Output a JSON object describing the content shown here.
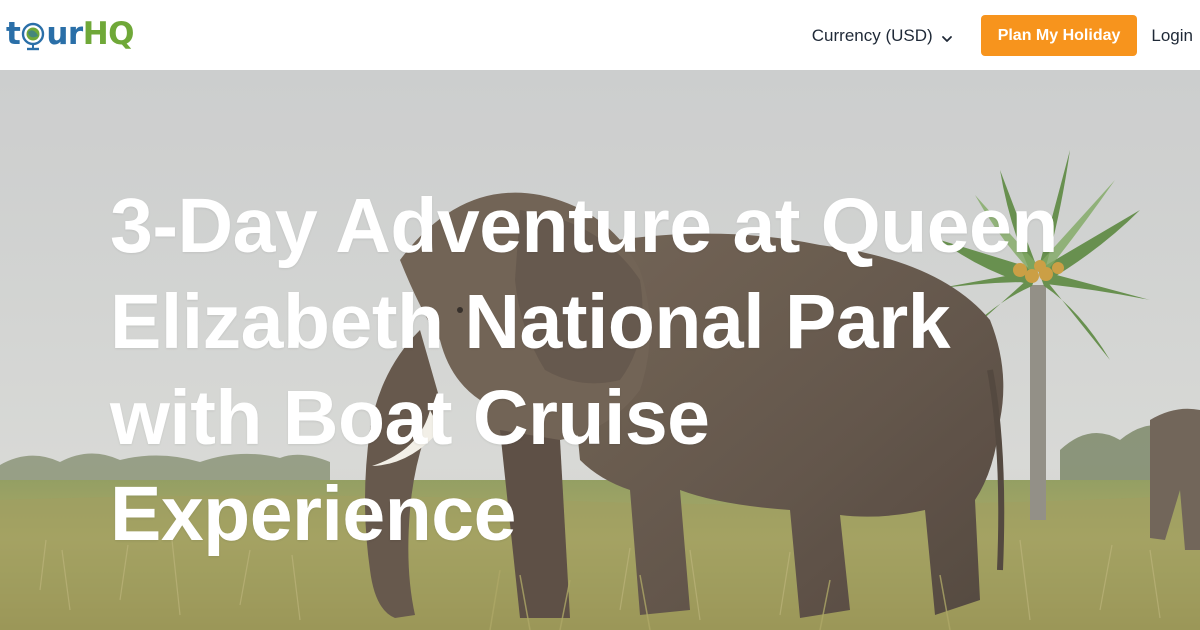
{
  "header": {
    "logo_text_left": "t",
    "logo_text_mid": "ur",
    "logo_text_right": "HQ",
    "currency_label": "Currency (USD)",
    "plan_button_label": "Plan My Holiday",
    "login_label": "Login"
  },
  "hero": {
    "title_line1": "3-Day Adventure at Queen",
    "title_line2": "Elizabeth National Park",
    "title_line3": "with Boat Cruise Experience"
  },
  "colors": {
    "accent": "#f7941d",
    "logo_blue": "#2a6fa8",
    "logo_green": "#6fa838",
    "title_text": "#ffffff"
  },
  "icons": {
    "currency_dropdown": "chevron-down-icon",
    "logo_globe": "globe-icon"
  }
}
